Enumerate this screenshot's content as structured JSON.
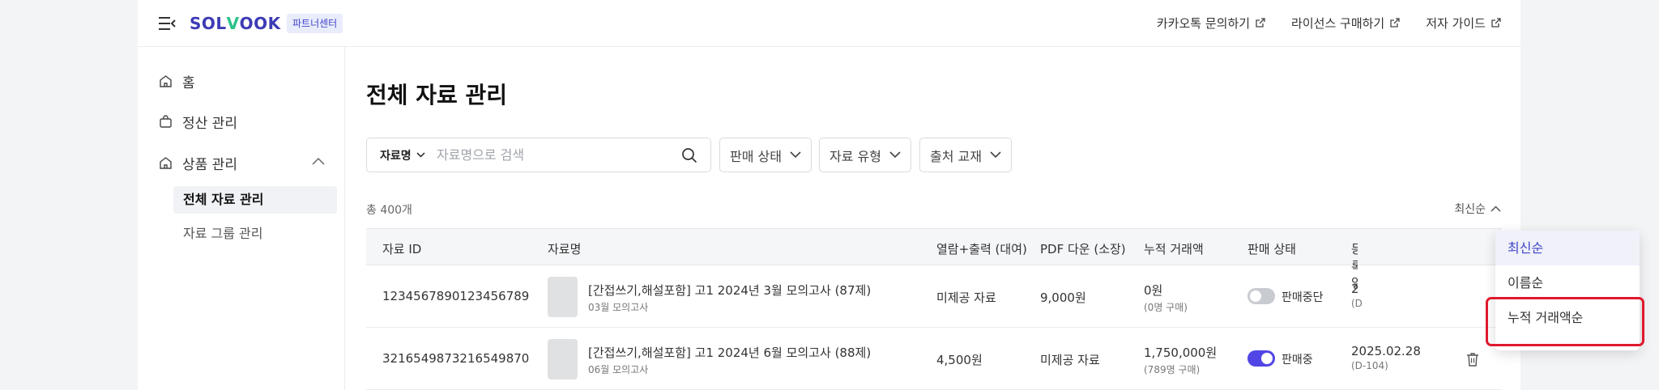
{
  "header": {
    "logo": {
      "part1": "SOL",
      "part2": "V",
      "part3": "OOK"
    },
    "badge": "파트너센터",
    "links": [
      "카카오톡 문의하기",
      "라이선스 구매하기",
      "저자 가이드"
    ]
  },
  "sidebar": {
    "home": "홈",
    "settlement": "정산 관리",
    "products": "상품 관리",
    "sub": {
      "all": "전체 자료 관리",
      "groups": "자료 그룹 관리"
    }
  },
  "main": {
    "title": "전체 자료 관리",
    "search": {
      "select": "자료명",
      "placeholder": "자료명으로 검색"
    },
    "filters": [
      "판매 상태",
      "자료 유형",
      "출처 교재"
    ],
    "total": "총 400개",
    "sort_label": "최신순"
  },
  "table": {
    "headers": [
      "자료 ID",
      "자료명",
      "열람+출력 (대여)",
      "PDF 다운 (소장)",
      "누적 거래액",
      "판매 상태",
      "등록일"
    ],
    "rows": [
      {
        "id": "1234567890123456789",
        "title": "[간접쓰기,해설포함] 고1 2024년 3월 모의고사 (87제)",
        "subtitle": "03월 모의고사",
        "rental": "미제공 자료",
        "download": "9,000원",
        "amount": "0원",
        "buyers": "(0명 구매)",
        "status": "판매중단",
        "status_on": false,
        "date": "2",
        "dday": "(D"
      },
      {
        "id": "3216549873216549870",
        "title": "[간접쓰기,해설포함] 고1 2024년 6월 모의고사 (88제)",
        "subtitle": "06월 모의고사",
        "rental": "4,500원",
        "download": "미제공 자료",
        "amount": "1,750,000원",
        "buyers": "(789명 구매)",
        "status": "판매중",
        "status_on": true,
        "date": "2025.02.28",
        "dday": "(D-104)"
      }
    ]
  },
  "sort_menu": {
    "options": [
      "최신순",
      "이름순",
      "누적 거래액순"
    ],
    "selected_index": 0
  },
  "colors": {
    "brand": "#3d3bb5",
    "accent": "#5146e5",
    "highlight": "#e0192d"
  }
}
